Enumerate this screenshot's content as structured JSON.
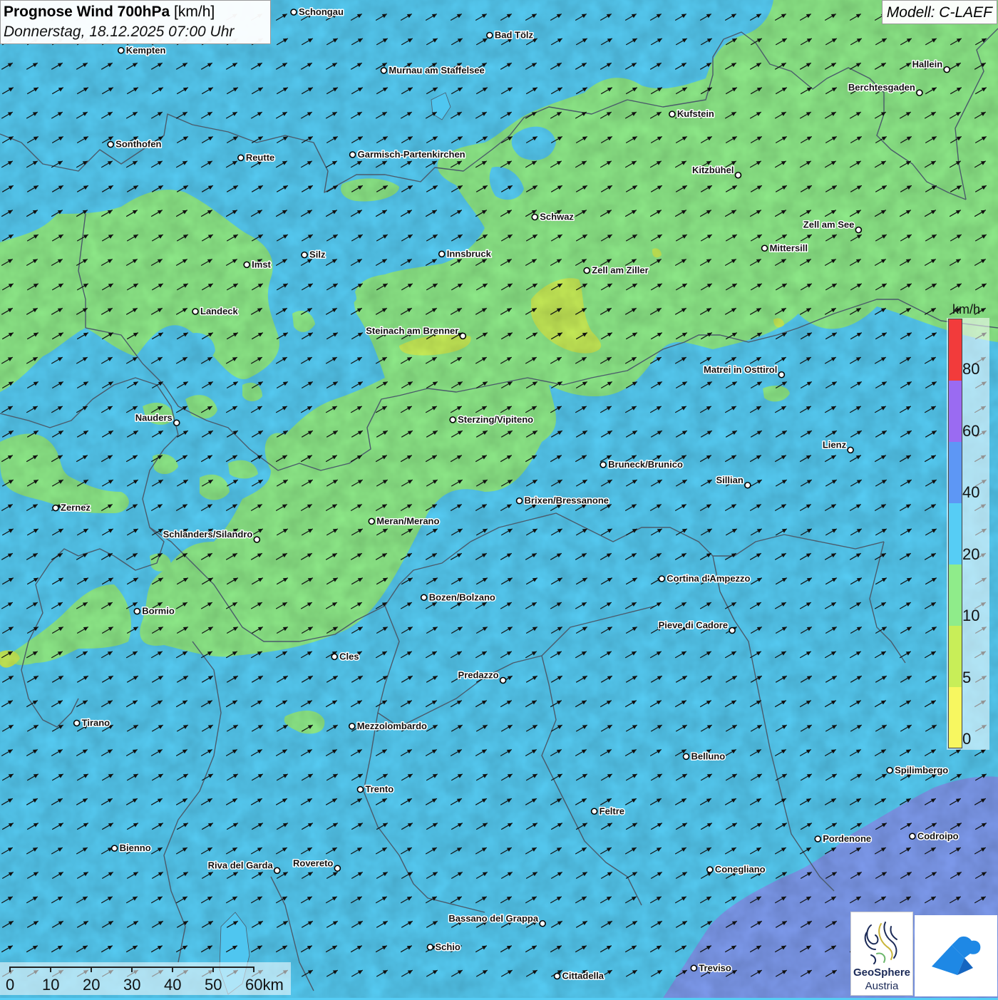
{
  "title": {
    "bold": "Prognose Wind 700hPa",
    "unit": " [km/h]",
    "datetime": "Donnerstag, 18.12.2025 07:00 Uhr"
  },
  "model": "Modell: C-LAEF",
  "cities": [
    {
      "name": "Schongau",
      "lon": 10.897,
      "lat": 47.812
    },
    {
      "name": "Bad Tölz",
      "lon": 11.556,
      "lat": 47.76
    },
    {
      "name": "Kempten",
      "lon": 10.316,
      "lat": 47.726
    },
    {
      "name": "Murnau am Staffelsee",
      "lon": 11.2,
      "lat": 47.681
    },
    {
      "name": "Hallein",
      "lon": 13.094,
      "lat": 47.683
    },
    {
      "name": "Berchtesgaden",
      "lon": 13.002,
      "lat": 47.631
    },
    {
      "name": "Kufstein",
      "lon": 12.17,
      "lat": 47.583
    },
    {
      "name": "Sonthofen",
      "lon": 10.281,
      "lat": 47.515
    },
    {
      "name": "Reutte",
      "lon": 10.719,
      "lat": 47.485
    },
    {
      "name": "Garmisch-Partenkirchen",
      "lon": 11.095,
      "lat": 47.492
    },
    {
      "name": "Kitzbühel",
      "lon": 12.392,
      "lat": 47.446
    },
    {
      "name": "Schwaz",
      "lon": 11.708,
      "lat": 47.352
    },
    {
      "name": "Zell am See",
      "lon": 12.797,
      "lat": 47.323
    },
    {
      "name": "Innsbruck",
      "lon": 11.395,
      "lat": 47.269
    },
    {
      "name": "Mittersill",
      "lon": 12.481,
      "lat": 47.282
    },
    {
      "name": "Silz",
      "lon": 10.933,
      "lat": 47.267
    },
    {
      "name": "Imst",
      "lon": 10.739,
      "lat": 47.245
    },
    {
      "name": "Zell am Ziller",
      "lon": 11.883,
      "lat": 47.232
    },
    {
      "name": "Landeck",
      "lon": 10.566,
      "lat": 47.14
    },
    {
      "name": "Steinach am Brenner",
      "lon": 11.466,
      "lat": 47.085
    },
    {
      "name": "Matrei in Osttirol",
      "lon": 12.538,
      "lat": 46.998
    },
    {
      "name": "Nauders",
      "lon": 10.503,
      "lat": 46.89
    },
    {
      "name": "Sterzing/Vipiteno",
      "lon": 11.432,
      "lat": 46.897
    },
    {
      "name": "Lienz",
      "lon": 12.77,
      "lat": 46.829
    },
    {
      "name": "Bruneck/Brunico",
      "lon": 11.938,
      "lat": 46.796
    },
    {
      "name": "Sillian",
      "lon": 12.424,
      "lat": 46.75
    },
    {
      "name": "Brixen/Bressanone",
      "lon": 11.656,
      "lat": 46.715
    },
    {
      "name": "Zernez",
      "lon": 10.096,
      "lat": 46.699
    },
    {
      "name": "Meran/Merano",
      "lon": 11.159,
      "lat": 46.669
    },
    {
      "name": "Schlanders/Silandro",
      "lon": 10.773,
      "lat": 46.628
    },
    {
      "name": "Cortina d'Ampezzo",
      "lon": 12.135,
      "lat": 46.54
    },
    {
      "name": "Bozen/Bolzano",
      "lon": 11.335,
      "lat": 46.498
    },
    {
      "name": "Bormio",
      "lon": 10.37,
      "lat": 46.467
    },
    {
      "name": "Pieve di Cadore",
      "lon": 12.372,
      "lat": 46.424
    },
    {
      "name": "Cles",
      "lon": 11.034,
      "lat": 46.365
    },
    {
      "name": "Predazzo",
      "lon": 11.601,
      "lat": 46.312
    },
    {
      "name": "Tirano",
      "lon": 10.167,
      "lat": 46.216
    },
    {
      "name": "Mezzolombardo",
      "lon": 11.093,
      "lat": 46.209
    },
    {
      "name": "Belluno",
      "lon": 12.217,
      "lat": 46.141
    },
    {
      "name": "Spilimbergo",
      "lon": 12.902,
      "lat": 46.11
    },
    {
      "name": "Trento",
      "lon": 11.121,
      "lat": 46.067
    },
    {
      "name": "Feltre",
      "lon": 11.908,
      "lat": 46.018
    },
    {
      "name": "Pordenone",
      "lon": 12.66,
      "lat": 45.956
    },
    {
      "name": "Codroipo",
      "lon": 12.978,
      "lat": 45.962
    },
    {
      "name": "Bienno",
      "lon": 10.294,
      "lat": 45.935
    },
    {
      "name": "Riva del Garda",
      "lon": 10.841,
      "lat": 45.885
    },
    {
      "name": "Rovereto",
      "lon": 11.044,
      "lat": 45.89
    },
    {
      "name": "Conegliano",
      "lon": 12.297,
      "lat": 45.887
    },
    {
      "name": "Bassano del Grappa",
      "lon": 11.734,
      "lat": 45.766
    },
    {
      "name": "Schio",
      "lon": 11.356,
      "lat": 45.713
    },
    {
      "name": "Treviso",
      "lon": 12.243,
      "lat": 45.666
    },
    {
      "name": "Cittadella",
      "lon": 11.783,
      "lat": 45.648
    }
  ],
  "wind_direction_deg": 240,
  "legend": {
    "unit": "km/h",
    "ticks": [
      "0",
      "5",
      "10",
      "20",
      "40",
      "60",
      "80"
    ],
    "colors": [
      "#f7f760",
      "#c8ee58",
      "#8fec8a",
      "#56cdf5",
      "#5d97f5",
      "#9a6bf2",
      "#f23b3b"
    ]
  },
  "scale": {
    "ticks": [
      "0",
      "10",
      "20",
      "30",
      "40",
      "50",
      "60km"
    ]
  },
  "logos": {
    "geosphere_name": "GeoSphere",
    "geosphere_sub": "Austria"
  },
  "colors": {
    "speed_10_20": "#8fec8a",
    "speed_20_40": "#56cdf5",
    "speed_5_10": "#c8ee58",
    "speed_40_60": "#7f9cf0",
    "borders": "#4a5a6a",
    "arrows": "#111111"
  }
}
